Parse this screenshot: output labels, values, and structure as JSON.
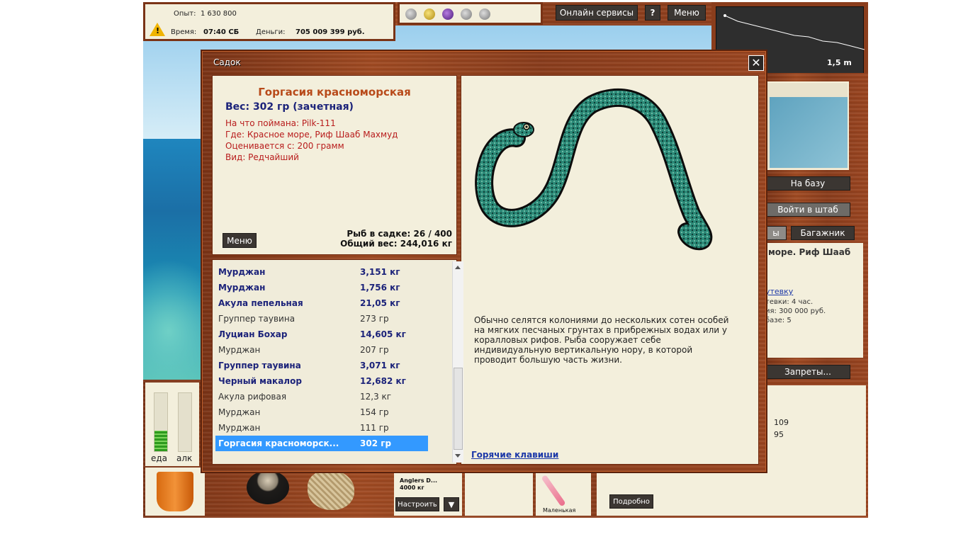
{
  "colors": {
    "wood": "#8a3d1c",
    "cream": "#f3efdc",
    "list_bold": "#1c237a",
    "detail_red": "#b81c1c",
    "title_orange": "#b84a1a",
    "selection": "#3399ff"
  },
  "stats": {
    "exp_label": "Опыт:",
    "exp_value": "1 630 800",
    "time_label": "Время:",
    "time_value": "07:40 СБ",
    "money_label": "Деньги:",
    "money_value": "705 009 399 руб."
  },
  "top_buttons": {
    "online": "Онлайн сервисы",
    "help": "?",
    "menu": "Меню"
  },
  "depth": {
    "value": "1,5 m"
  },
  "right_panel": {
    "to_base": "На базу",
    "enter_hq": "Войти в штаб",
    "tab_partial": "ы",
    "trunk": "Багажник",
    "location_title": "море. Риф Шааб",
    "trip_link": "утевку",
    "trip_line1": "тевки: 4 час.",
    "trip_line2": "ия: 300 000 руб.",
    "trip_line3": "базе: 5",
    "bans": "Запреты...",
    "num1": "109",
    "num2": "95"
  },
  "bottom": {
    "meter_food": "еда",
    "meter_alc": "алк",
    "food_level": 0.35,
    "alc_level": 0.0,
    "reel_name": "Anglers D...",
    "reel_load": "4000 кг",
    "setup_button": "Настроить",
    "dropdown_glyph": "▼",
    "lure_caption": "Маленькая",
    "details_button": "Подробно"
  },
  "dialog": {
    "title": "Садок",
    "close_glyph": "✕",
    "fish_name": "Горгасия красноморская",
    "weight_line": "Вес: 302 гр (зачетная)",
    "details": [
      "На что поймана: Pilk-111",
      "Где: Красное море, Риф Шааб Махмуд",
      "Оценивается с: 200 грамм",
      "Вид: Редчайший"
    ],
    "menu_button": "Меню",
    "count_line": "Рыб в садке: 26 / 400",
    "total_line": "Общий вес: 244,016 кг",
    "description": "Обычно селятся колониями до нескольких сотен особей на мягких песчаных грунтах в прибрежных водах или у коралловых рифов. Рыба сооружает себе индивидуальную вертикальную нору, в которой проводит большую часть жизни.",
    "hotkeys_link": "Горячие клавиши"
  },
  "catch_list": [
    {
      "name": "Мурджан",
      "weight": "3,151 кг",
      "style": "big"
    },
    {
      "name": "Мурджан",
      "weight": "1,756 кг",
      "style": "big"
    },
    {
      "name": "Акула пепельная",
      "weight": "21,05 кг",
      "style": "big"
    },
    {
      "name": "Группер таувина",
      "weight": "273 гр",
      "style": "small"
    },
    {
      "name": "Луциан Бохар",
      "weight": "14,605 кг",
      "style": "big"
    },
    {
      "name": "Мурджан",
      "weight": "207 гр",
      "style": "small"
    },
    {
      "name": "Группер таувина",
      "weight": "3,071 кг",
      "style": "big"
    },
    {
      "name": "Черный макалор",
      "weight": "12,682 кг",
      "style": "big"
    },
    {
      "name": "Акула рифовая",
      "weight": "12,3 кг",
      "style": "small"
    },
    {
      "name": "Мурджан",
      "weight": "154 гр",
      "style": "small"
    },
    {
      "name": "Мурджан",
      "weight": "111 гр",
      "style": "small"
    },
    {
      "name": "Горгасия красноморск...",
      "weight": "302 гр",
      "style": "sel"
    }
  ]
}
